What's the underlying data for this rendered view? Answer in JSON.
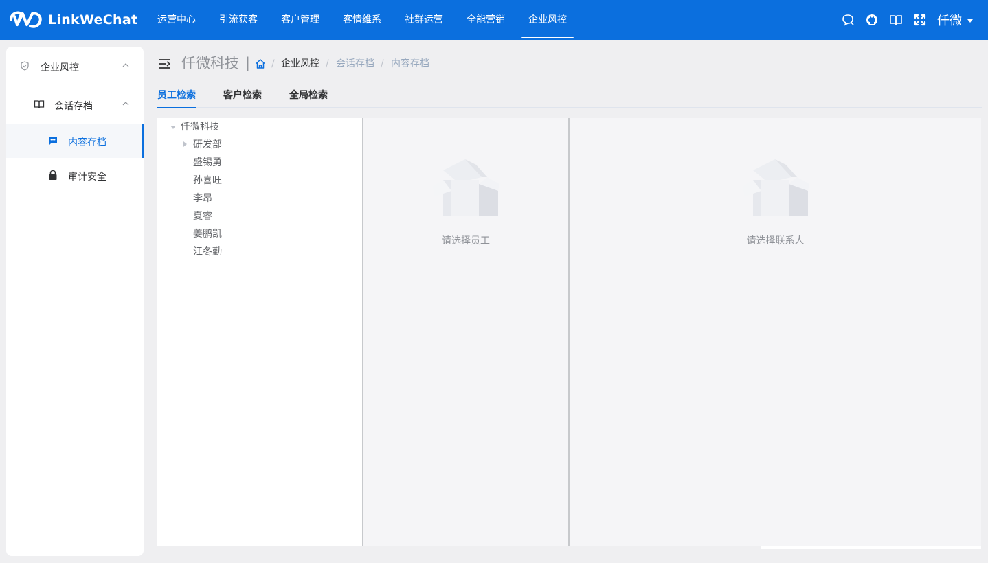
{
  "app": {
    "logo_text": "LinkWeChat",
    "nav": [
      "运营中心",
      "引流获客",
      "客户管理",
      "客情维系",
      "社群运营",
      "全能营销",
      "企业风控"
    ],
    "active_nav": "企业风控",
    "user_name": "仟微"
  },
  "sidebar": {
    "group": "企业风控",
    "subgroup": "会话存档",
    "items": [
      {
        "label": "内容存档",
        "active": true
      },
      {
        "label": "审计安全",
        "active": false
      }
    ]
  },
  "header": {
    "company": "仟微科技",
    "breadcrumb": [
      "企业风控",
      "会话存档",
      "内容存档"
    ]
  },
  "tabs": [
    "员工检索",
    "客户检索",
    "全局检索"
  ],
  "active_tab": "员工检索",
  "tree": {
    "root": "仟微科技",
    "children": [
      "研发部",
      "盛锡勇",
      "孙喜旺",
      "李昂",
      "夏睿",
      "姜鹏凯",
      "江冬勤"
    ]
  },
  "empty": {
    "staff": "请选择员工",
    "contact": "请选择联系人"
  },
  "colors": {
    "primary": "#0b6fde",
    "topbar": "#0b6fde",
    "page_bg": "#efeff1",
    "panel_bg": "#f5f5f7"
  }
}
